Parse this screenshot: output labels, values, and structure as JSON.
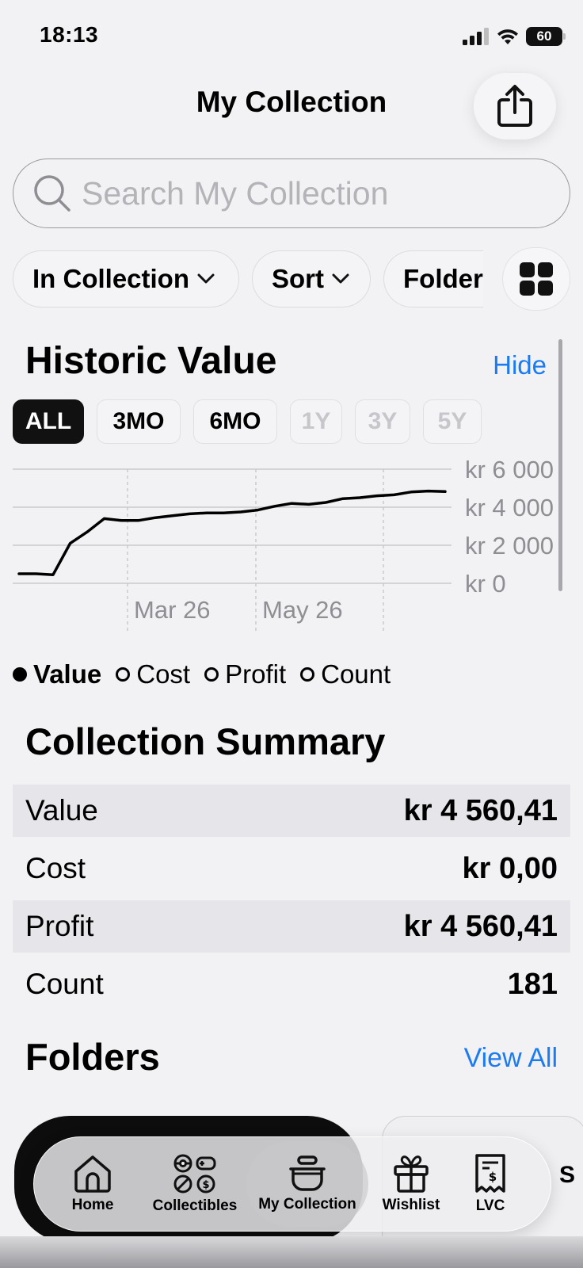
{
  "status_bar": {
    "time": "18:13",
    "battery": "60"
  },
  "header": {
    "title": "My Collection",
    "share_icon": "share-icon"
  },
  "search": {
    "placeholder": "Search My Collection",
    "value": ""
  },
  "filters": {
    "in_collection": "In Collection",
    "sort": "Sort",
    "folders": "Folders"
  },
  "historic": {
    "title": "Historic Value",
    "hide_label": "Hide",
    "ranges": [
      "ALL",
      "3MO",
      "6MO",
      "1Y",
      "3Y",
      "5Y"
    ],
    "active_range": "ALL",
    "disabled_ranges": [
      "1Y",
      "3Y",
      "5Y"
    ]
  },
  "chart_data": {
    "type": "line",
    "series": [
      {
        "values": [
          500,
          500,
          450,
          2100,
          2700,
          3400,
          3300,
          3300,
          3450,
          3550,
          3650,
          3700,
          3700,
          3750,
          3850,
          4050,
          4200,
          4150,
          4250,
          4450,
          4500,
          4600,
          4650,
          4800,
          4850,
          4820
        ]
      }
    ],
    "x_tick_labels": [
      "Mar 26",
      "May 26"
    ],
    "y_tick_labels": [
      "kr 6 000",
      "kr 4 000",
      "kr 2 000",
      "kr 0"
    ],
    "ylim": [
      0,
      6000
    ],
    "grid": true
  },
  "legend": [
    {
      "label": "Value",
      "selected": true
    },
    {
      "label": "Cost",
      "selected": false
    },
    {
      "label": "Profit",
      "selected": false
    },
    {
      "label": "Count",
      "selected": false
    }
  ],
  "summary": {
    "title": "Collection Summary",
    "rows": [
      {
        "label": "Value",
        "value": "kr 4 560,41"
      },
      {
        "label": "Cost",
        "value": "kr 0,00"
      },
      {
        "label": "Profit",
        "value": "kr 4 560,41"
      },
      {
        "label": "Count",
        "value": "181"
      }
    ]
  },
  "folders": {
    "title": "Folders",
    "view_all": "View All"
  },
  "tabbar": {
    "tabs": [
      {
        "label": "Home",
        "icon": "home-icon"
      },
      {
        "label": "Collectibles",
        "icon": "collectibles-icon"
      },
      {
        "label": "My Collection",
        "icon": "collection-pot-icon"
      },
      {
        "label": "Wishlist",
        "icon": "gift-icon"
      },
      {
        "label": "LVC",
        "icon": "receipt-icon"
      }
    ],
    "active": "My Collection"
  }
}
